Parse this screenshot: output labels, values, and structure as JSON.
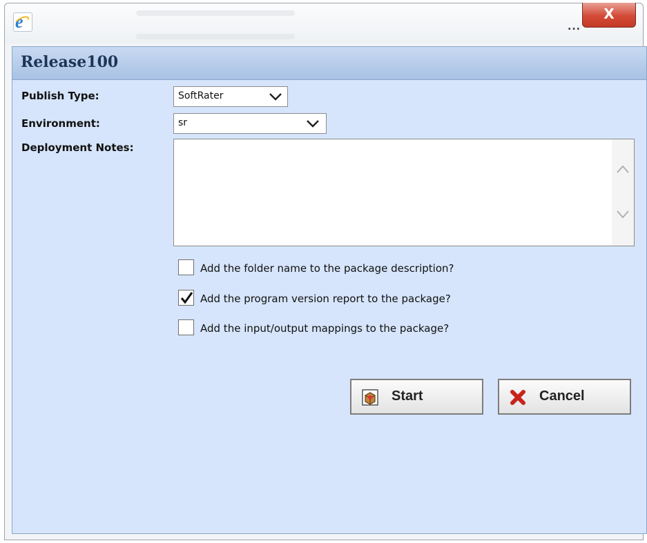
{
  "window": {
    "title_ellipsis": "...",
    "close_label": "X",
    "icon": "internet-explorer-icon"
  },
  "dialog": {
    "title": "Release100",
    "publish_type": {
      "label": "Publish Type:",
      "value": "SoftRater"
    },
    "environment": {
      "label": "Environment:",
      "value": "sr"
    },
    "deployment_notes": {
      "label": "Deployment Notes:",
      "value": ""
    },
    "checkboxes": [
      {
        "label": "Add the folder name to the package description?",
        "checked": false
      },
      {
        "label": "Add the program version report to the package?",
        "checked": true
      },
      {
        "label": "Add the input/output mappings to the package?",
        "checked": false
      }
    ],
    "buttons": {
      "start": {
        "label": "Start",
        "icon": "package-box-icon"
      },
      "cancel": {
        "label": "Cancel",
        "icon": "red-x-icon"
      }
    }
  },
  "colors": {
    "panel_bg": "#d6e5fb",
    "header_bg": "#a9c2e4",
    "close_red": "#d44a36"
  }
}
